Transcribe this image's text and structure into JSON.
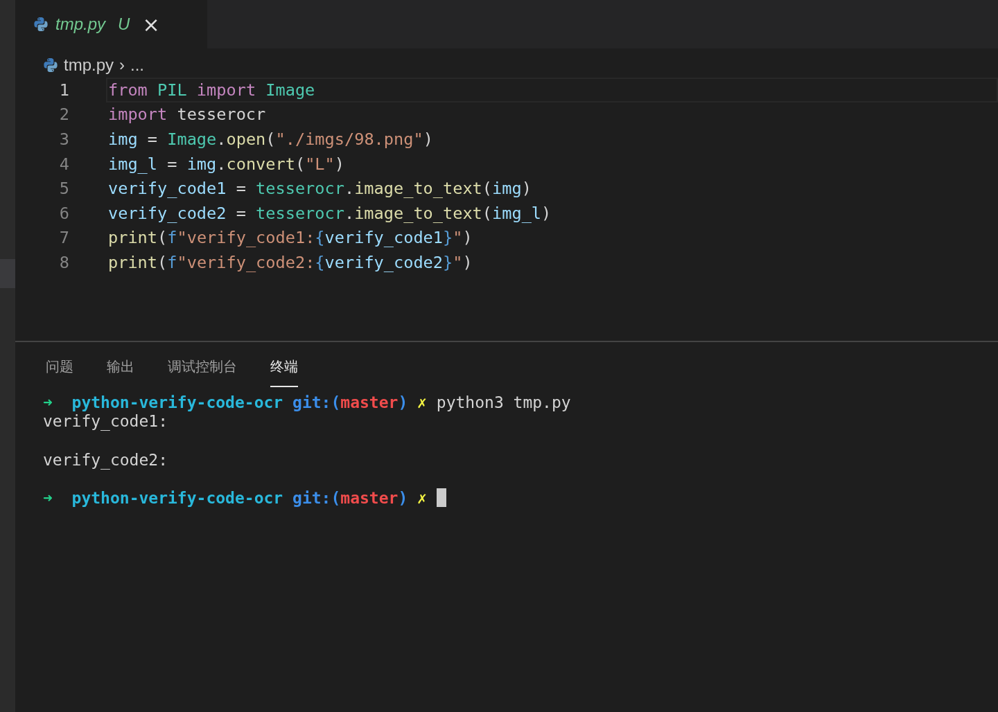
{
  "editor_tabs": [
    {
      "label": "tmp.py",
      "status": "U",
      "selected": true,
      "close": "×"
    }
  ],
  "breadcrumb": {
    "file": "tmp.py",
    "separator": "›",
    "rest": "..."
  },
  "code_lines": [
    {
      "number": "1",
      "current": true,
      "tokens": [
        {
          "kind": "kw",
          "text": "from "
        },
        {
          "kind": "type",
          "text": "PIL "
        },
        {
          "kind": "kw",
          "text": "import "
        },
        {
          "kind": "type",
          "text": "Image"
        }
      ]
    },
    {
      "number": "2",
      "current": false,
      "tokens": [
        {
          "kind": "kw",
          "text": "import"
        },
        {
          "kind": "plain",
          "text": " tesserocr"
        }
      ]
    },
    {
      "number": "3",
      "current": false,
      "tokens": [
        {
          "kind": "var",
          "text": "img"
        },
        {
          "kind": "plain",
          "text": " = "
        },
        {
          "kind": "type",
          "text": "Image"
        },
        {
          "kind": "plain",
          "text": "."
        },
        {
          "kind": "fn",
          "text": "open"
        },
        {
          "kind": "plain",
          "text": "("
        },
        {
          "kind": "str",
          "text": "\"./imgs/98.png\""
        },
        {
          "kind": "plain",
          "text": ")"
        }
      ]
    },
    {
      "number": "4",
      "current": false,
      "tokens": [
        {
          "kind": "var",
          "text": "img_l"
        },
        {
          "kind": "plain",
          "text": " = "
        },
        {
          "kind": "var",
          "text": "img"
        },
        {
          "kind": "plain",
          "text": "."
        },
        {
          "kind": "fn",
          "text": "convert"
        },
        {
          "kind": "plain",
          "text": "("
        },
        {
          "kind": "str",
          "text": "\"L\""
        },
        {
          "kind": "plain",
          "text": ")"
        }
      ]
    },
    {
      "number": "5",
      "current": false,
      "tokens": [
        {
          "kind": "var",
          "text": "verify_code1"
        },
        {
          "kind": "plain",
          "text": " = "
        },
        {
          "kind": "type",
          "text": "tesserocr"
        },
        {
          "kind": "plain",
          "text": "."
        },
        {
          "kind": "fn",
          "text": "image_to_text"
        },
        {
          "kind": "plain",
          "text": "("
        },
        {
          "kind": "var",
          "text": "img"
        },
        {
          "kind": "plain",
          "text": ")"
        }
      ]
    },
    {
      "number": "6",
      "current": false,
      "tokens": [
        {
          "kind": "var",
          "text": "verify_code2"
        },
        {
          "kind": "plain",
          "text": " = "
        },
        {
          "kind": "type",
          "text": "tesserocr"
        },
        {
          "kind": "plain",
          "text": "."
        },
        {
          "kind": "fn",
          "text": "image_to_text"
        },
        {
          "kind": "plain",
          "text": "("
        },
        {
          "kind": "var",
          "text": "img_l"
        },
        {
          "kind": "plain",
          "text": ")"
        }
      ]
    },
    {
      "number": "7",
      "current": false,
      "tokens": [
        {
          "kind": "fn",
          "text": "print"
        },
        {
          "kind": "plain",
          "text": "("
        },
        {
          "kind": "brace",
          "text": "f"
        },
        {
          "kind": "str",
          "text": "\"verify_code1:"
        },
        {
          "kind": "brace",
          "text": "{"
        },
        {
          "kind": "var",
          "text": "verify_code1"
        },
        {
          "kind": "brace",
          "text": "}"
        },
        {
          "kind": "str",
          "text": "\""
        },
        {
          "kind": "plain",
          "text": ")"
        }
      ]
    },
    {
      "number": "8",
      "current": false,
      "tokens": [
        {
          "kind": "fn",
          "text": "print"
        },
        {
          "kind": "plain",
          "text": "("
        },
        {
          "kind": "brace",
          "text": "f"
        },
        {
          "kind": "str",
          "text": "\"verify_code2:"
        },
        {
          "kind": "brace",
          "text": "{"
        },
        {
          "kind": "var",
          "text": "verify_code2"
        },
        {
          "kind": "brace",
          "text": "}"
        },
        {
          "kind": "str",
          "text": "\""
        },
        {
          "kind": "plain",
          "text": ")"
        }
      ]
    }
  ],
  "panel_tabs": [
    {
      "label": "问题",
      "selected": false
    },
    {
      "label": "输出",
      "selected": false
    },
    {
      "label": "调试控制台",
      "selected": false
    },
    {
      "label": "终端",
      "selected": true
    }
  ],
  "terminal_lines": [
    {
      "kind": "prompt",
      "arrow": "➜",
      "directory": "python-verify-code-ocr",
      "git_label": "git:(",
      "branch": "master",
      "git_close": ")",
      "dirty": "✗",
      "command": "python3 tmp.py",
      "cursor": false
    },
    {
      "kind": "output",
      "text": "verify_code1:"
    },
    {
      "kind": "blank"
    },
    {
      "kind": "output",
      "text": "verify_code2:"
    },
    {
      "kind": "blank"
    },
    {
      "kind": "prompt",
      "arrow": "➜",
      "directory": "python-verify-code-ocr",
      "git_label": "git:(",
      "branch": "master",
      "git_close": ")",
      "dirty": "✗",
      "cursor": true
    }
  ]
}
